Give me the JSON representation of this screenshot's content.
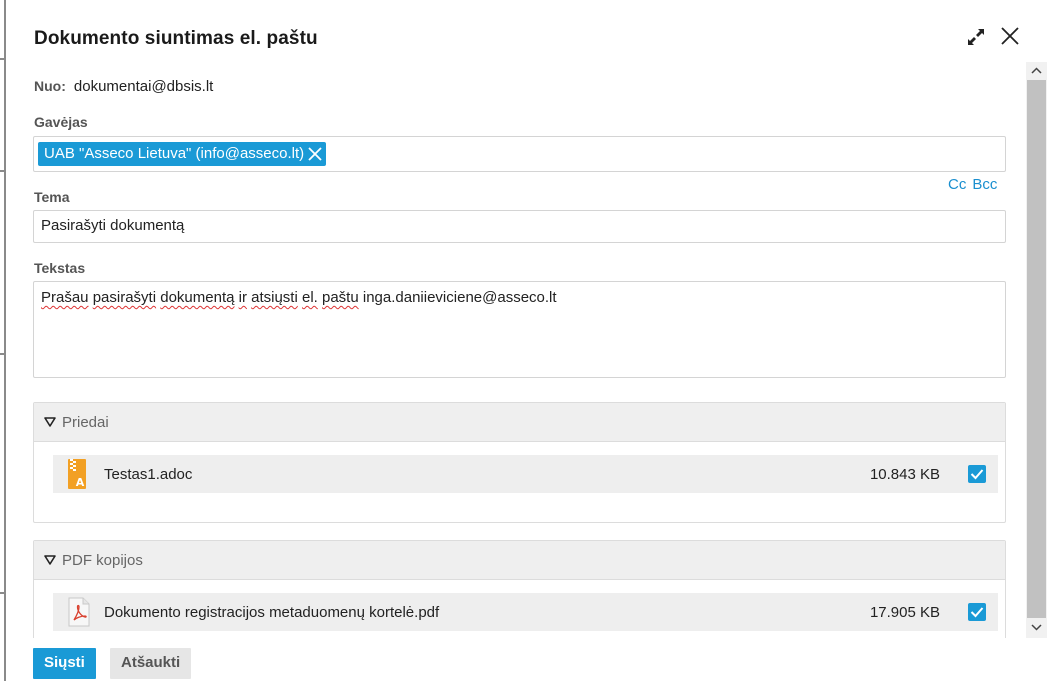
{
  "dialog": {
    "title": "Dokumento siuntimas el. paštu",
    "expand_icon": "expand-icon",
    "close_icon": "close-icon"
  },
  "from": {
    "label": "Nuo:",
    "value": "dokumentai@dbsis.lt"
  },
  "recipient": {
    "label": "Gavėjas",
    "chips": [
      {
        "label": "UAB \"Asseco Lietuva\" (info@asseco.lt)"
      }
    ]
  },
  "cc_links": {
    "cc": "Cc",
    "bcc": "Bcc"
  },
  "subject": {
    "label": "Tema",
    "value": "Pasirašyti dokumentą"
  },
  "body": {
    "label": "Tekstas",
    "text_parts": [
      "Prašau",
      "pasirašyti",
      "dokumentą",
      "ir",
      "atsiųsti",
      "el.",
      "paštu",
      "inga.daniieviciene@asseco.lt"
    ]
  },
  "attachments": {
    "title": "Priedai",
    "files": [
      {
        "name": "Testas1.adoc",
        "size": "10.843 KB",
        "checked": true,
        "icon": "archive-file-icon"
      }
    ]
  },
  "pdf_copies": {
    "title": "PDF kopijos",
    "files": [
      {
        "name": "Dokumento registracijos metaduomenų kortelė.pdf",
        "size": "17.905 KB",
        "checked": true,
        "icon": "pdf-file-icon"
      }
    ]
  },
  "buttons": {
    "send": "Siųsti",
    "cancel": "Atšaukti"
  },
  "colors": {
    "accent": "#1a9ad6",
    "link": "#1a8fcf",
    "panel_header": "#efefef"
  }
}
